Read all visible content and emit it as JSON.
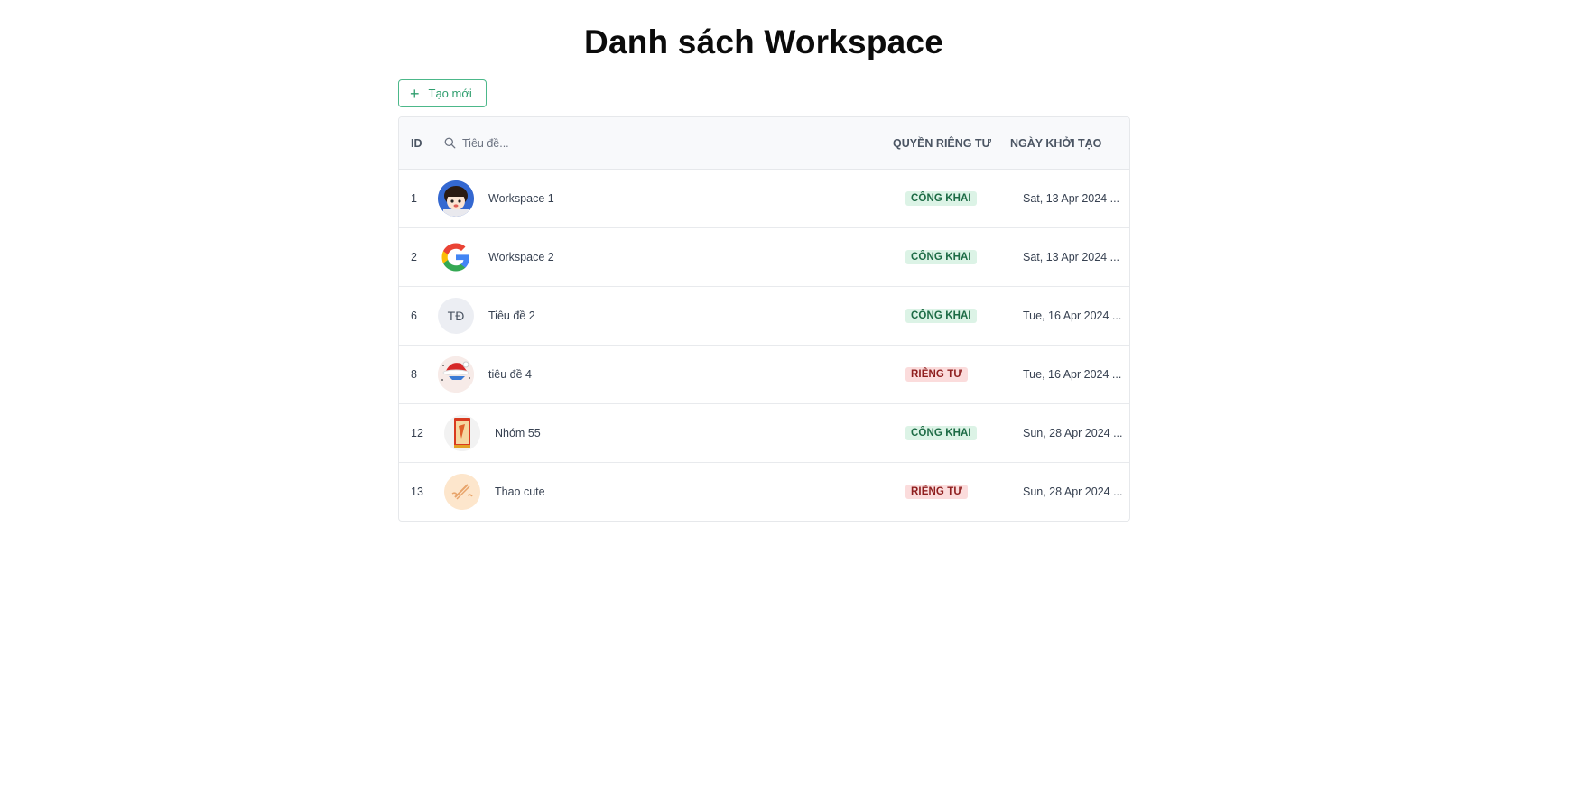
{
  "page": {
    "title": "Danh sách Workspace"
  },
  "toolbar": {
    "create_label": "Tạo mới"
  },
  "table": {
    "headers": {
      "id": "ID",
      "search_placeholder": "Tiêu đề...",
      "privacy": "QUYỀN RIÊNG TƯ",
      "created": "NGÀY KHỞI TẠO"
    },
    "rows": [
      {
        "id": "1",
        "title": "Workspace 1",
        "privacy": "CÔNG KHAI",
        "created": "Sat, 13 Apr 2024 ...",
        "avatar": "cartoon-girl-avatar"
      },
      {
        "id": "2",
        "title": "Workspace 2",
        "privacy": "CÔNG KHAI",
        "created": "Sat, 13 Apr 2024 ...",
        "avatar": "google-logo-avatar"
      },
      {
        "id": "6",
        "title": "Tiêu đề 2",
        "privacy": "CÔNG KHAI",
        "created": "Tue, 16 Apr 2024 ...",
        "avatar": "initials-avatar",
        "initials": "TĐ"
      },
      {
        "id": "8",
        "title": "tiêu đề 4",
        "privacy": "RIÊNG TƯ",
        "created": "Tue, 16 Apr 2024 ...",
        "avatar": "christmas-hat-avatar"
      },
      {
        "id": "12",
        "title": "Nhóm 55",
        "privacy": "CÔNG KHAI",
        "created": "Sun, 28 Apr 2024 ...",
        "avatar": "book-cover-avatar"
      },
      {
        "id": "13",
        "title": "Thao cute",
        "privacy": "RIÊNG TƯ",
        "created": "Sun, 28 Apr 2024 ...",
        "avatar": "sketch-avatar"
      }
    ]
  },
  "colors": {
    "accent": "#2f9e6e",
    "public_badge_bg": "#dcf3e6",
    "private_badge_bg": "#fbdcdc"
  }
}
